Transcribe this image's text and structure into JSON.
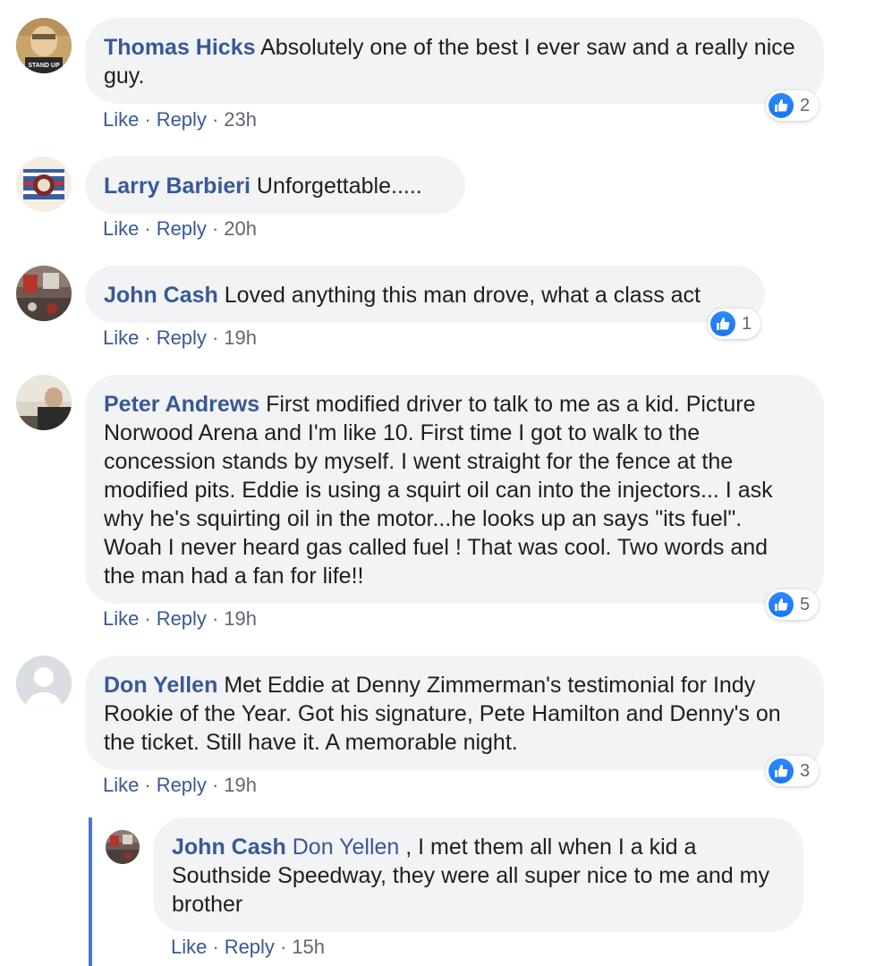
{
  "colors": {
    "author_link": "#385898",
    "bubble_bg": "#f2f3f5",
    "meta_text": "#606770",
    "like_blue": "#1877f2",
    "reply_thread_bar": "#4a76d4"
  },
  "comments": [
    {
      "author": "Thomas Hicks",
      "text": "Absolutely one of the best I ever saw and a really nice guy.",
      "avatar_text": "STAND UP",
      "like": "Like",
      "reply": "Reply",
      "time": "23h",
      "reactions": "2",
      "reaction_icon": "thumbs-up-icon"
    },
    {
      "author": "Larry Barbieri",
      "text": "Unforgettable.....",
      "like": "Like",
      "reply": "Reply",
      "time": "20h"
    },
    {
      "author": "John Cash",
      "text": "Loved anything this man drove, what a class act",
      "like": "Like",
      "reply": "Reply",
      "time": "19h",
      "reactions": "1",
      "reaction_icon": "thumbs-up-icon"
    },
    {
      "author": "Peter Andrews",
      "text": "First modified driver to talk to me as a kid. Picture Norwood Arena and I'm like 10. First time I got to walk to the concession stands by myself. I went straight for the fence at the modified pits. Eddie is using a squirt oil can into the injectors... I ask why he's squirting oil in the motor...he looks up an says \"its fuel\". Woah I never heard gas called fuel ! That was cool. Two words and the man had a fan for life!!",
      "like": "Like",
      "reply": "Reply",
      "time": "19h",
      "reactions": "5",
      "reaction_icon": "thumbs-up-icon"
    },
    {
      "author": "Don Yellen",
      "text": "Met Eddie at Denny Zimmerman's testimonial for Indy Rookie of the Year. Got his signature, Pete Hamilton and Denny's on the ticket. Still have it. A memorable night.",
      "like": "Like",
      "reply": "Reply",
      "time": "19h",
      "reactions": "3",
      "reaction_icon": "thumbs-up-icon"
    }
  ],
  "reply": {
    "author": "John Cash",
    "mention": "Don Yellen",
    "text": ", I met them all when I a kid a Southside Speedway, they were all super nice to me and my brother",
    "like": "Like",
    "reply": "Reply",
    "time": "15h"
  }
}
